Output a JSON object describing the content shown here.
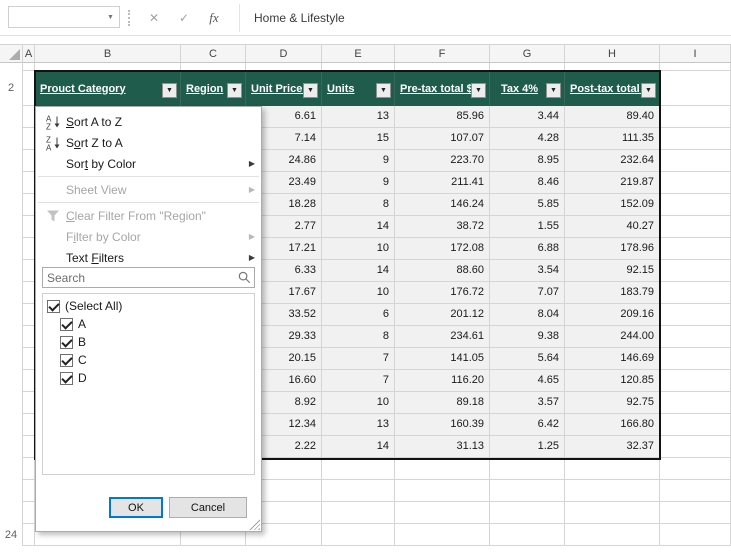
{
  "formula_bar": {
    "name_box_value": "",
    "cancel_glyph": "✕",
    "enter_glyph": "✓",
    "fx_label": "fx",
    "formula_text": "Home & Lifestyle"
  },
  "icons": {
    "name_box_arrow": "▼",
    "filter_arrow": "▼",
    "submenu_arrow": "▶"
  },
  "grid": {
    "column_letters": [
      "A",
      "B",
      "C",
      "D",
      "E",
      "F",
      "G",
      "H",
      "I"
    ],
    "row_labels": {
      "header_row": "2",
      "bottom_row": "24"
    }
  },
  "table": {
    "headers": [
      "Prouct Category",
      "Region",
      "Unit Price $",
      "Units",
      "Pre-tax total $",
      "Tax 4%",
      "Post-tax total $"
    ],
    "rows": [
      [
        "6.61",
        "13",
        "85.96",
        "3.44",
        "89.40"
      ],
      [
        "7.14",
        "15",
        "107.07",
        "4.28",
        "111.35"
      ],
      [
        "24.86",
        "9",
        "223.70",
        "8.95",
        "232.64"
      ],
      [
        "23.49",
        "9",
        "211.41",
        "8.46",
        "219.87"
      ],
      [
        "18.28",
        "8",
        "146.24",
        "5.85",
        "152.09"
      ],
      [
        "2.77",
        "14",
        "38.72",
        "1.55",
        "40.27"
      ],
      [
        "17.21",
        "10",
        "172.08",
        "6.88",
        "178.96"
      ],
      [
        "6.33",
        "14",
        "88.60",
        "3.54",
        "92.15"
      ],
      [
        "17.67",
        "10",
        "176.72",
        "7.07",
        "183.79"
      ],
      [
        "33.52",
        "6",
        "201.12",
        "8.04",
        "209.16"
      ],
      [
        "29.33",
        "8",
        "234.61",
        "9.38",
        "244.00"
      ],
      [
        "20.15",
        "7",
        "141.05",
        "5.64",
        "146.69"
      ],
      [
        "16.60",
        "7",
        "116.20",
        "4.65",
        "120.85"
      ],
      [
        "8.92",
        "10",
        "89.18",
        "3.57",
        "92.75"
      ],
      [
        "12.34",
        "13",
        "160.39",
        "6.42",
        "166.80"
      ],
      [
        "2.22",
        "14",
        "31.13",
        "1.25",
        "32.37"
      ]
    ]
  },
  "filter_menu": {
    "column": "Region",
    "items": [
      {
        "label": "Sort A to Z",
        "icon": "sort-az-icon",
        "accel": 0,
        "enabled": true,
        "submenu": false
      },
      {
        "label": "Sort Z to A",
        "icon": "sort-za-icon",
        "accel": 1,
        "enabled": true,
        "submenu": false
      },
      {
        "label": "Sort by Color",
        "accel": 3,
        "enabled": true,
        "submenu": true
      },
      {
        "separator": true
      },
      {
        "label": "Sheet View",
        "accel": null,
        "enabled": false,
        "submenu": true
      },
      {
        "separator": true
      },
      {
        "label": "Clear Filter From \"Region\"",
        "icon": "clear-filter-icon",
        "accel": 0,
        "enabled": false,
        "submenu": false
      },
      {
        "label": "Filter by Color",
        "accel": 1,
        "enabled": false,
        "submenu": true
      },
      {
        "label": "Text Filters",
        "accel": 5,
        "enabled": true,
        "submenu": true
      }
    ],
    "search": {
      "placeholder": "Search"
    },
    "values": [
      {
        "label": "(Select All)",
        "checked": true
      },
      {
        "label": "A",
        "checked": true
      },
      {
        "label": "B",
        "checked": true
      },
      {
        "label": "C",
        "checked": true
      },
      {
        "label": "D",
        "checked": true
      }
    ],
    "ok_label": "OK",
    "cancel_label": "Cancel"
  }
}
